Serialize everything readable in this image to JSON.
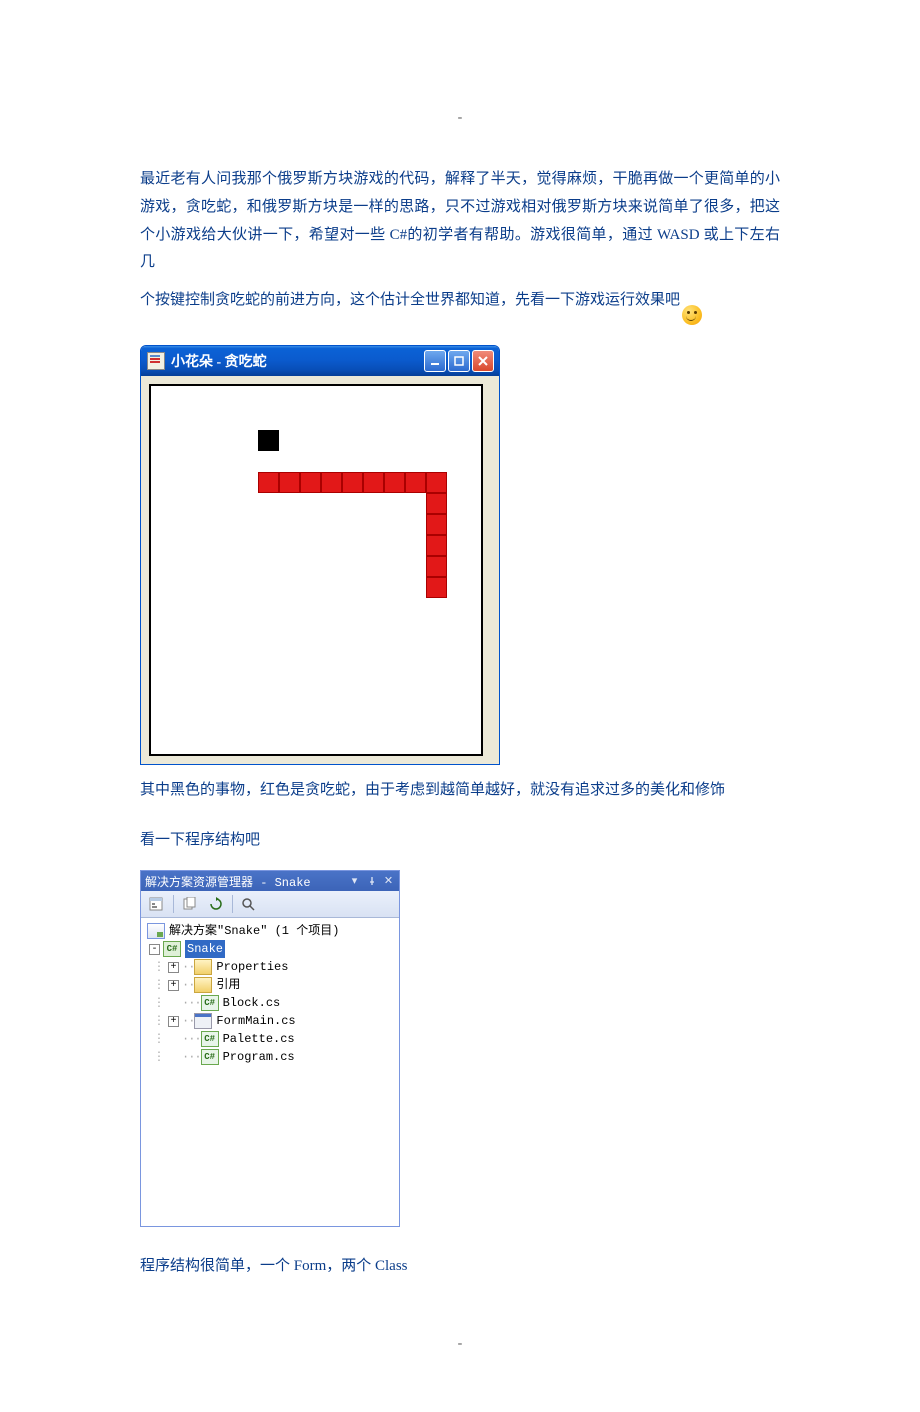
{
  "dash": "-",
  "text": {
    "p1": "最近老有人问我那个俄罗斯方块游戏的代码，解释了半天，觉得麻烦，干脆再做一个更简单的小游戏，贪吃蛇，和俄罗斯方块是一样的思路，只不过游戏相对俄罗斯方块来说简单了很多，把这个小游戏给大伙讲一下，希望对一些 C#的初学者有帮助。游戏很简单，通过 WASD 或上下左右几",
    "p2": "个按键控制贪吃蛇的前进方向，这个估计全世界都知道，先看一下游戏运行效果吧",
    "p3": "其中黑色的事物，红色是贪吃蛇，由于考虑到越简单越好，就没有追求过多的美化和修饰",
    "p4": "看一下程序结构吧",
    "p5": "程序结构很简单，一个 Form，两个 Class"
  },
  "snake_window": {
    "title": "小花朵 - 贪吃蛇",
    "cell_size": 21,
    "food": {
      "col": 5,
      "row": 2
    },
    "snake": [
      {
        "col": 5,
        "row": 4
      },
      {
        "col": 6,
        "row": 4
      },
      {
        "col": 7,
        "row": 4
      },
      {
        "col": 8,
        "row": 4
      },
      {
        "col": 9,
        "row": 4
      },
      {
        "col": 10,
        "row": 4
      },
      {
        "col": 11,
        "row": 4
      },
      {
        "col": 12,
        "row": 4
      },
      {
        "col": 13,
        "row": 4
      },
      {
        "col": 13,
        "row": 5
      },
      {
        "col": 13,
        "row": 6
      },
      {
        "col": 13,
        "row": 7
      },
      {
        "col": 13,
        "row": 8
      },
      {
        "col": 13,
        "row": 9
      }
    ]
  },
  "solution_explorer": {
    "title": "解决方案资源管理器 - Snake",
    "root": "解决方案\"Snake\" (1 个项目)",
    "project": "Snake",
    "items": {
      "properties": "Properties",
      "references": "引用",
      "block": "Block.cs",
      "formmain": "FormMain.cs",
      "palette": "Palette.cs",
      "program": "Program.cs"
    }
  }
}
